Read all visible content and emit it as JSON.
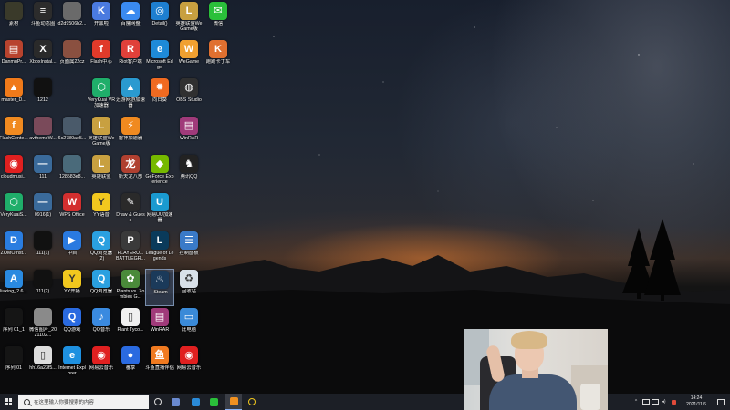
{
  "desktop": {
    "columns": [
      [
        {
          "label": "素材",
          "icon": "image-thumbnail-icon",
          "color": "#3a3a2a"
        },
        {
          "label": "DanmuPr...",
          "icon": "archive-books-icon",
          "color": "#b8432e"
        },
        {
          "label": "master_D...",
          "icon": "orange-app-icon",
          "color": "#f07a1a"
        },
        {
          "label": "FlashCente...",
          "icon": "flash-center-icon",
          "color": "#f08a20"
        },
        {
          "label": "cloudmusi...",
          "icon": "netease-music-icon",
          "color": "#e02020"
        },
        {
          "label": "VeryKuaiS...",
          "icon": "verykuai-icon",
          "color": "#1fae6a"
        },
        {
          "label": "ZOMOInst...",
          "icon": "zomo-icon",
          "color": "#2a7de0"
        },
        {
          "label": "liuxing_2.6...",
          "icon": "liuxing-icon",
          "color": "#2a8ae0"
        },
        {
          "label": "序列 01_1",
          "icon": "video-file-icon",
          "color": "#151515"
        },
        {
          "label": "序列 01",
          "icon": "video-file-icon",
          "color": "#151515"
        }
      ],
      [
        {
          "label": "斗鱼动态图",
          "icon": "list-file-icon",
          "color": "#2c2c2c"
        },
        {
          "label": "XboxInstal...",
          "icon": "xbox-icon",
          "color": "#2a2a2a"
        },
        {
          "label": "1212",
          "icon": "video-file-icon",
          "color": "#111111"
        },
        {
          "label": "avthemeW...",
          "icon": "image-thumbnail-icon",
          "color": "#7a4a5a"
        },
        {
          "label": "111",
          "icon": "line-file-icon",
          "color": "#3a6a9a"
        },
        {
          "label": "0916(1)",
          "icon": "line-file-icon",
          "color": "#3a6a9a"
        },
        {
          "label": "111(1)",
          "icon": "video-file-icon",
          "color": "#111111"
        },
        {
          "label": "111(2)",
          "icon": "video-file-icon",
          "color": "#111111"
        },
        {
          "label": "微信图片_2021102...",
          "icon": "image-thumbnail-icon",
          "color": "#8a8a8a"
        },
        {
          "label": "hh16a23f5...",
          "icon": "document-icon",
          "color": "#dddddd"
        }
      ],
      [
        {
          "label": "d2d9506b2...",
          "icon": "image-thumbnail-icon",
          "color": "#6a6a6a"
        },
        {
          "label": "页面属22cz",
          "icon": "image-thumbnail-icon",
          "color": "#8a5040"
        },
        null,
        {
          "label": "6c2780ae5...",
          "icon": "image-thumbnail-icon",
          "color": "#4a5a6a"
        },
        {
          "label": "128583e8...",
          "icon": "image-thumbnail-icon",
          "color": "#4a6a7a"
        },
        {
          "label": "WPS Office",
          "icon": "wps-icon",
          "color": "#d32f2f"
        },
        {
          "label": "中目",
          "icon": "blue-app-icon",
          "color": "#2a7ae0"
        },
        {
          "label": "YY开播",
          "icon": "yy-live-icon",
          "color": "#f2c81e"
        },
        {
          "label": "QQ游戏",
          "icon": "qq-game-icon",
          "color": "#2a6ae0"
        },
        {
          "label": "Internet Explorer",
          "icon": "internet-explorer-icon",
          "color": "#1e90e0"
        }
      ],
      [
        {
          "label": "开黑啦",
          "icon": "kaiheila-icon",
          "color": "#4a7ae0"
        },
        {
          "label": "Flash中心",
          "icon": "flash-icon",
          "color": "#e03a2a"
        },
        {
          "label": "VeryKuai VR加速器",
          "icon": "verykuai-icon",
          "color": "#1fae6a"
        },
        {
          "label": "英雄联盟WeGame版",
          "icon": "league-icon",
          "color": "#c8a040"
        },
        {
          "label": "英雄联盟",
          "icon": "league-icon",
          "color": "#c8a040"
        },
        {
          "label": "YY语音",
          "icon": "yy-icon",
          "color": "#f2c81e"
        },
        {
          "label": "QQ浏览器 (2)",
          "icon": "qq-browser-icon",
          "color": "#2aa0e0"
        },
        {
          "label": "QQ浏览器",
          "icon": "qq-browser-icon",
          "color": "#2aa0e0"
        },
        {
          "label": "QQ音乐",
          "icon": "qq-music-icon",
          "color": "#3a8ae0"
        },
        {
          "label": "网易云音乐",
          "icon": "netease-music-icon",
          "color": "#e02020"
        }
      ],
      [
        {
          "label": "百度网盘",
          "icon": "baidu-netdisk-icon",
          "color": "#3a8af0"
        },
        {
          "label": "Riot客户端",
          "icon": "riot-icon",
          "color": "#e0403a"
        },
        {
          "label": "迅游网游加速器",
          "icon": "xunyou-icon",
          "color": "#2a9ad0"
        },
        {
          "label": "雷神加速器",
          "icon": "leishen-icon",
          "color": "#f08a20"
        },
        {
          "label": "新天龙八部",
          "icon": "tlbb-icon",
          "color": "#b04030"
        },
        {
          "label": "Draw & Guess",
          "icon": "draw-guess-icon",
          "color": "#2a2a2a"
        },
        {
          "label": "PLAYERU... BATTLEGR...",
          "icon": "pubg-icon",
          "color": "#3a3a3a"
        },
        {
          "label": "Plants vs. Zombies G...",
          "icon": "pvz-icon",
          "color": "#4a8a3a"
        },
        {
          "label": "Plant Tyco...",
          "icon": "document-icon",
          "color": "#f0f0f0"
        },
        {
          "label": "番享",
          "icon": "blue-circle-app-icon",
          "color": "#2a6ae0"
        }
      ],
      [
        {
          "label": "Detail()",
          "icon": "globe-icon",
          "color": "#1e7fd0"
        },
        {
          "label": "Microsoft Edge",
          "icon": "edge-icon",
          "color": "#1e8ad8"
        },
        {
          "label": "向日葵",
          "icon": "sunlogin-icon",
          "color": "#f06a20"
        },
        null,
        {
          "label": "GeForce Experience",
          "icon": "geforce-icon",
          "color": "#76b900"
        },
        {
          "label": "网易UU加速器",
          "icon": "uu-booster-icon",
          "color": "#1a9ad0"
        },
        {
          "label": "League of Legends",
          "icon": "league-icon",
          "color": "#0a3a5a"
        },
        {
          "label": "Steam",
          "icon": "steam-icon",
          "color": "#1b3a5a",
          "selected": true
        },
        {
          "label": "WinRAR",
          "icon": "winrar-icon",
          "color": "#a03a7a"
        },
        {
          "label": "斗鱼直播伴侣",
          "icon": "douyu-icon",
          "color": "#f07a20"
        }
      ],
      [
        {
          "label": "英雄联盟WeGame版",
          "icon": "league-icon",
          "color": "#c8a040"
        },
        {
          "label": "WeGame",
          "icon": "wegame-icon",
          "color": "#f0a030"
        },
        {
          "label": "OBS Studio",
          "icon": "obs-icon",
          "color": "#303030"
        },
        {
          "label": "WinRAR",
          "icon": "winrar-icon",
          "color": "#a03a7a"
        },
        {
          "label": "腾讯QQ",
          "icon": "qq-penguin-icon",
          "color": "#222222"
        },
        null,
        {
          "label": "控制面板",
          "icon": "control-panel-icon",
          "color": "#3a7ac8"
        },
        {
          "label": "回收站",
          "icon": "recycle-bin-icon",
          "color": "#d8e0e8"
        },
        {
          "label": "此电脑",
          "icon": "this-pc-icon",
          "color": "#3a8ad8"
        },
        {
          "label": "网易云音乐",
          "icon": "netease-music-icon",
          "color": "#e02020"
        }
      ],
      [
        {
          "label": "微信",
          "icon": "wechat-icon",
          "color": "#2ac03a"
        },
        {
          "label": "跑跑卡丁车",
          "icon": "kart-icon",
          "color": "#e07030"
        }
      ]
    ]
  },
  "taskbar": {
    "search_placeholder": "在这里输入你要搜索的内容",
    "pinned": [
      {
        "icon": "task-view-icon",
        "color": "#dddddd"
      },
      {
        "icon": "file-explorer-icon",
        "color": "#6a8ad0"
      },
      {
        "icon": "edge-icon",
        "color": "#2a8ad8"
      },
      {
        "icon": "wechat-icon",
        "color": "#2ac03a"
      },
      {
        "icon": "orange-app-icon",
        "color": "#f09020",
        "active": true
      },
      {
        "icon": "yy-ring-icon",
        "color": "#f2c81e"
      }
    ],
    "tray": {
      "time": "14:24",
      "date": "2021/11/6"
    }
  }
}
